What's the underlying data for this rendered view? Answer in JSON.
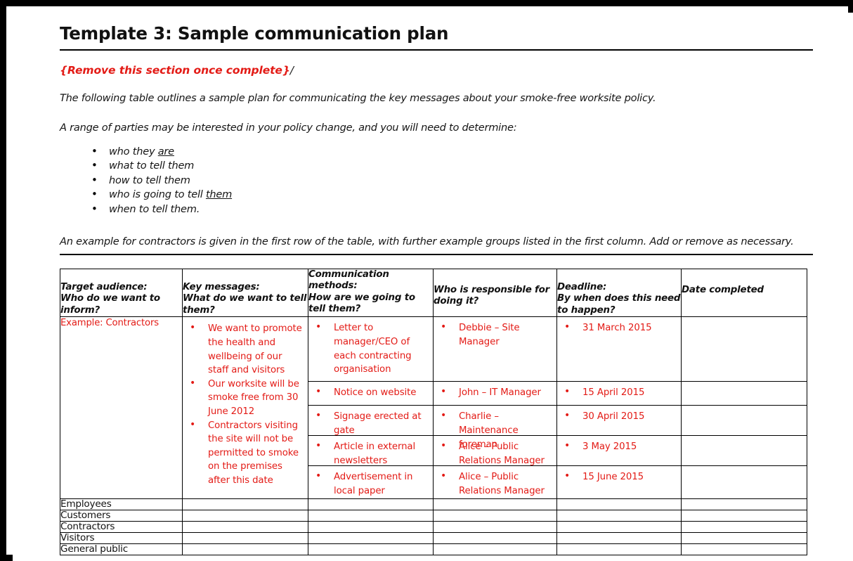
{
  "document": {
    "title": "Template 3: Sample communication plan",
    "red_note": "{Remove this section once complete}",
    "red_note_trailing": "/",
    "paragraph_1": "The following table outlines a sample plan for communicating the key messages about your smoke-free worksite policy.",
    "paragraph_2": "A range of parties may be interested in your policy change, and you will need to determine:",
    "paragraph_3": "An example for contractors is given in the first row of the table, with further example groups listed in the first column. Add or remove as necessary.",
    "bullets": [
      {
        "pre": "who they ",
        "underlined": "are",
        "post": ""
      },
      {
        "pre": "what to tell them",
        "underlined": "",
        "post": ""
      },
      {
        "pre": "how to tell them",
        "underlined": "",
        "post": ""
      },
      {
        "pre": "who is going to tell ",
        "underlined": "them",
        "post": ""
      },
      {
        "pre": "when to tell them.",
        "underlined": "",
        "post": ""
      }
    ],
    "accent_red": "#E31B16",
    "text_black": "#111111"
  },
  "table": {
    "headers": [
      "Target audience:\nWho do we want to inform?",
      "Key messages:\nWhat do we want to tell them?",
      "Communication methods:\nHow are we going to tell them?",
      "Who is responsible for doing it?",
      "Deadline:\nBy when does this need to happen?",
      "Date completed"
    ],
    "headers_lines": {
      "target_audience": [
        "Target audience:",
        "Who do we want to",
        "inform?"
      ],
      "key_messages": [
        "Key messages:",
        "What do we want to tell",
        "them?"
      ],
      "communication_methods": [
        "Communication",
        "methods:",
        "How are we going to",
        "tell them?"
      ],
      "responsible": [
        "Who is responsible for",
        "doing it?"
      ],
      "deadline": [
        "Deadline:",
        "By when does this need",
        "to happen?"
      ],
      "date_completed": [
        "Date completed"
      ]
    },
    "example_row": {
      "target_audience": "Example: Contractors",
      "key_messages": [
        "We want to promote the health and wellbeing of our staff and visitors",
        "Our worksite will be smoke free from 30 June 2012",
        "Contractors visiting the site will not be permitted to smoke on the premises after this date"
      ],
      "activities": [
        {
          "method": "Letter to manager/CEO of each contracting organisation",
          "responsible": "Debbie – Site Manager",
          "deadline": "31 March 2015",
          "date_completed": ""
        },
        {
          "method": "Notice on website",
          "responsible": "John – IT Manager",
          "deadline": "15 April 2015",
          "date_completed": ""
        },
        {
          "method": "Signage erected at gate",
          "responsible": "Charlie – Maintenance foreman",
          "deadline": "30 April 2015",
          "date_completed": ""
        },
        {
          "method": "Article in external newsletters",
          "responsible": "Alice – Public Relations Manager",
          "deadline": "3 May 2015",
          "date_completed": ""
        },
        {
          "method": "Advertisement in local paper",
          "responsible": "Alice – Public Relations Manager",
          "deadline": "15 June 2015",
          "date_completed": ""
        }
      ]
    },
    "audience_rows": [
      "Employees",
      "Customers",
      "Contractors",
      "Visitors",
      "General public"
    ]
  }
}
